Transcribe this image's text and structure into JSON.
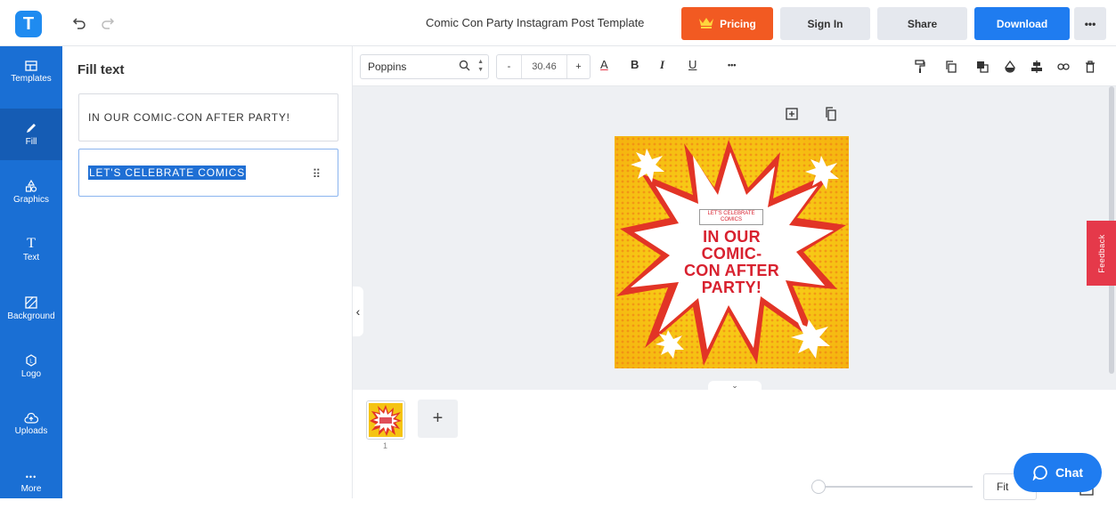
{
  "app": {
    "logo_letter": "T",
    "doc_title": "Comic Con Party Instagram Post Template"
  },
  "header": {
    "pricing": "Pricing",
    "sign_in": "Sign In",
    "share": "Share",
    "download": "Download",
    "more": "•••"
  },
  "rail": [
    {
      "label": "Templates",
      "icon": "templates-icon"
    },
    {
      "label": "Fill",
      "icon": "pencil-icon",
      "active": true
    },
    {
      "label": "Graphics",
      "icon": "shapes-icon"
    },
    {
      "label": "Text",
      "icon": "text-icon"
    },
    {
      "label": "Background",
      "icon": "background-icon"
    },
    {
      "label": "Logo",
      "icon": "logo-icon"
    },
    {
      "label": "Uploads",
      "icon": "upload-icon"
    },
    {
      "label": "More",
      "icon": "more-icon"
    }
  ],
  "panel": {
    "title": "Fill text",
    "fields": [
      {
        "value": "IN OUR COMIC-CON AFTER PARTY!"
      },
      {
        "value": "LET'S CELEBRATE COMICS",
        "selected": true
      }
    ]
  },
  "toolbar": {
    "font": "Poppins",
    "font_size": "30.46",
    "minus": "-",
    "plus": "+",
    "color_letter": "A",
    "bold": "B",
    "italic": "I",
    "underline": "U",
    "more": "•••"
  },
  "post": {
    "subtitle": "LET'S CELEBRATE COMICS",
    "headline_lines": [
      "IN OUR",
      "COMIC-",
      "CON AFTER",
      "PARTY!"
    ],
    "colors": {
      "bg_yellow": "#f7d10c",
      "bg_orange": "#f39a11",
      "red": "#d8212f",
      "white": "#ffffff"
    }
  },
  "feedback": "Feedback",
  "pages": {
    "current": "1",
    "add": "+"
  },
  "zoom": {
    "mode": "Fit"
  },
  "chat": {
    "label": "Chat"
  },
  "colors": {
    "accent": "#1f7cf0",
    "pricing": "#f25a22",
    "rail": "#1a6fd4",
    "feedback": "#e5394a"
  }
}
